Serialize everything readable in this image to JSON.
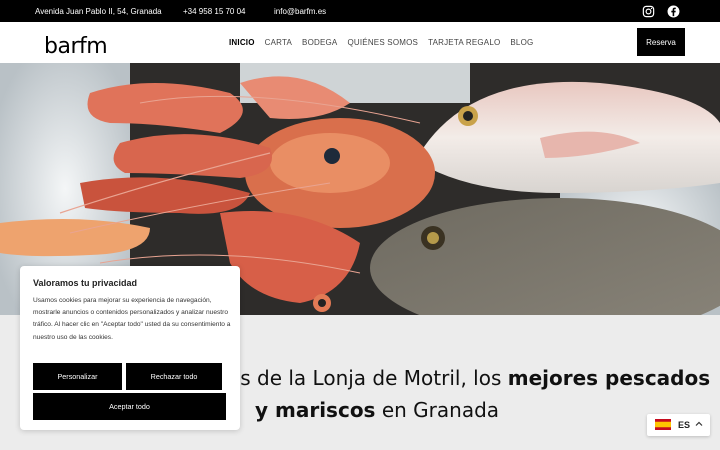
{
  "topbar": {
    "address": "Avenida Juan Pablo II, 54, Granada",
    "phone": "+34 958 15 70 04",
    "email": "info@barfm.es"
  },
  "header": {
    "logo_text": "barfm",
    "nav": [
      "INICIO",
      "CARTA",
      "BODEGA",
      "QUIÉNES SOMOS",
      "TARJETA REGALO",
      "BLOG"
    ],
    "reserve_label": "Reserva"
  },
  "tagline": {
    "line1_a": "os de la Lonja de Motril, los ",
    "line1_b": "mejores pescados",
    "line2_a": "y mariscos",
    "line2_b": " en Granada"
  },
  "cookie": {
    "title": "Valoramos tu privacidad",
    "body": "Usamos cookies para mejorar su experiencia de navegación, mostrarle anuncios o contenidos personalizados y analizar nuestro tráfico. Al hacer clic en \"Aceptar todo\" usted da su consentimiento a nuestro uso de las cookies.",
    "customize": "Personalizar",
    "reject": "Rechazar todo",
    "accept": "Aceptar todo"
  },
  "language": {
    "code": "ES"
  },
  "colors": {
    "bar": "#000000",
    "page": "#ececec"
  },
  "icons": [
    "instagram-icon",
    "facebook-icon",
    "spain-flag-icon",
    "chevron-up-icon"
  ]
}
